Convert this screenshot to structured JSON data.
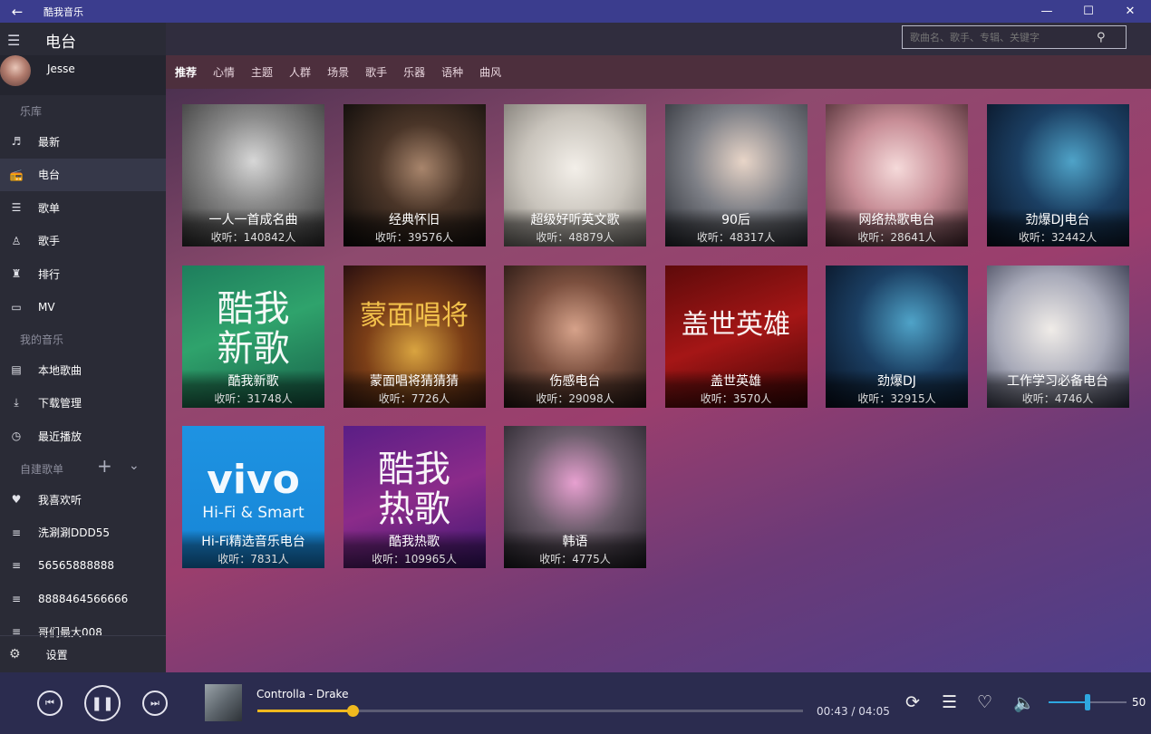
{
  "app": {
    "title": "酷我音乐"
  },
  "window_controls": {
    "back": "←",
    "minimize": "—",
    "maximize": "☐",
    "close": "✕"
  },
  "header": {
    "title": "电台",
    "search_placeholder": "歌曲名、歌手、专辑、关键字"
  },
  "user": {
    "name": "Jesse"
  },
  "sidebar": {
    "library_label": "乐库",
    "library": [
      {
        "label": "最新",
        "icon": "music-note-icon",
        "glyph": "♬"
      },
      {
        "label": "电台",
        "icon": "radio-icon",
        "glyph": "📻",
        "active": true
      },
      {
        "label": "歌单",
        "icon": "playlist-icon",
        "glyph": "☰"
      },
      {
        "label": "歌手",
        "icon": "singer-icon",
        "glyph": "♙"
      },
      {
        "label": "排行",
        "icon": "trophy-icon",
        "glyph": "♜"
      },
      {
        "label": "MV",
        "icon": "mv-icon",
        "glyph": "▭"
      }
    ],
    "mymusic_label": "我的音乐",
    "mymusic": [
      {
        "label": "本地歌曲",
        "icon": "local-music-icon",
        "glyph": "▤"
      },
      {
        "label": "下载管理",
        "icon": "download-icon",
        "glyph": "⤓"
      },
      {
        "label": "最近播放",
        "icon": "recent-icon",
        "glyph": "◷"
      }
    ],
    "custom_label": "自建歌单",
    "custom_add": "+",
    "custom_expand": "⌄",
    "custom": [
      {
        "label": "我喜欢听",
        "icon": "heart-icon",
        "glyph": "♥"
      },
      {
        "label": "洗涮涮DDD55",
        "icon": "list-icon",
        "glyph": "≡"
      },
      {
        "label": "56565888888",
        "icon": "list-icon",
        "glyph": "≡"
      },
      {
        "label": "8888464566666",
        "icon": "list-icon",
        "glyph": "≡"
      },
      {
        "label": "哥们最大008",
        "icon": "list-icon",
        "glyph": "≡"
      }
    ],
    "settings": {
      "label": "设置",
      "icon": "gear-icon",
      "glyph": "⚙"
    }
  },
  "tabs": [
    "推荐",
    "心情",
    "主题",
    "人群",
    "场景",
    "歌手",
    "乐器",
    "语种",
    "曲风"
  ],
  "active_tab": 0,
  "cards": [
    {
      "name": "一人一首成名曲",
      "count": "收听：140842人",
      "style": "bw"
    },
    {
      "name": "经典怀旧",
      "count": "收听：39576人",
      "style": "dark"
    },
    {
      "name": "超级好听英文歌",
      "count": "收听：48879人",
      "style": "light"
    },
    {
      "name": "90后",
      "count": "收听：48317人",
      "style": "gray"
    },
    {
      "name": "网络热歌电台",
      "count": "收听：28641人",
      "style": "pink"
    },
    {
      "name": "劲爆DJ电台",
      "count": "收听：32442人",
      "style": "dj"
    },
    {
      "name": "酷我新歌",
      "count": "收听：31748人",
      "style": "green",
      "art_text": "酷我\n新歌"
    },
    {
      "name": "蒙面唱将猜猜猜",
      "count": "收听：7726人",
      "style": "mask",
      "art_text": "蒙面唱将"
    },
    {
      "name": "伤感电台",
      "count": "收听：29098人",
      "style": "warm"
    },
    {
      "name": "盖世英雄",
      "count": "收听：3570人",
      "style": "red",
      "art_text": "盖世英雄"
    },
    {
      "name": "劲爆DJ",
      "count": "收听：32915人",
      "style": "dj"
    },
    {
      "name": "工作学习必备电台",
      "count": "收听：4746人",
      "style": "soft"
    },
    {
      "name": "Hi-Fi精选音乐电台",
      "count": "收听：7831人",
      "style": "vivo",
      "art_text": "vivo",
      "art_sub": "Hi-Fi & Smart"
    },
    {
      "name": "酷我热歌",
      "count": "收听：109965人",
      "style": "purple",
      "art_text": "酷我\n热歌"
    },
    {
      "name": "韩语",
      "count": "收听：4775人",
      "style": "kpop"
    }
  ],
  "player": {
    "song": "Controlla - Drake",
    "time": "00:43 / 04:05",
    "progress": 0.175,
    "volume": 50,
    "icons": [
      "prev-icon",
      "pause-icon",
      "next-icon",
      "repeat-icon",
      "queue-icon",
      "heart-icon",
      "volume-icon"
    ]
  },
  "colors": {
    "accent": "#f0b91e",
    "volume": "#2ea7e0",
    "titlebar": "#3b3d8e"
  }
}
